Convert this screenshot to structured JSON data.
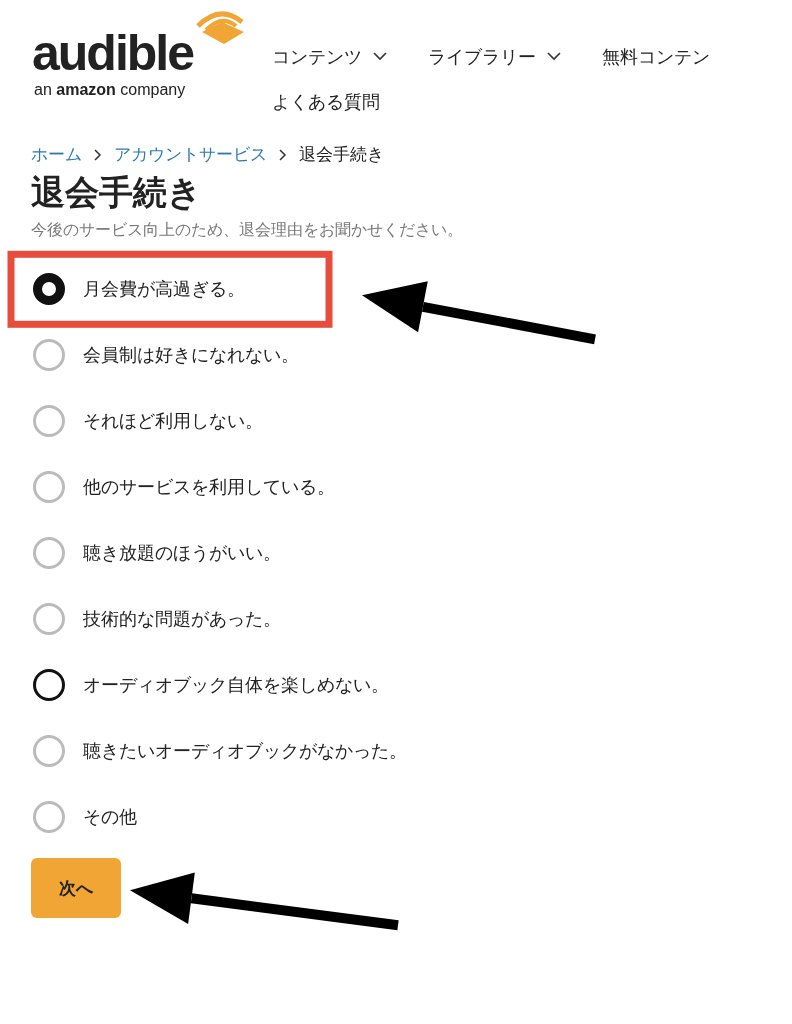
{
  "logo": {
    "name": "audible",
    "tagline": "an **amazon** company"
  },
  "nav": [
    {
      "label": "コンテンツ",
      "dropdown": true
    },
    {
      "label": "ライブラリー",
      "dropdown": true
    },
    {
      "label": "無料コンテン",
      "dropdown": false
    },
    {
      "label": "よくある質問",
      "dropdown": false
    }
  ],
  "breadcrumb": [
    {
      "label": "ホーム",
      "link": true
    },
    {
      "label": "アカウントサービス",
      "link": true
    },
    {
      "label": "退会手続き",
      "link": false
    }
  ],
  "title": "退会手続き",
  "subtitle": "今後のサービス向上のため、退会理由をお聞かせください。",
  "options": [
    {
      "label": "月会費が高過ぎる。",
      "selected": true,
      "focused": false,
      "highlighted": true,
      "arrow": true
    },
    {
      "label": "会員制は好きになれない。",
      "selected": false,
      "focused": false,
      "highlighted": false,
      "arrow": false
    },
    {
      "label": "それほど利用しない。",
      "selected": false,
      "focused": false,
      "highlighted": false,
      "arrow": false
    },
    {
      "label": "他のサービスを利用している。",
      "selected": false,
      "focused": false,
      "highlighted": false,
      "arrow": false
    },
    {
      "label": "聴き放題のほうがいい。",
      "selected": false,
      "focused": false,
      "highlighted": false,
      "arrow": false
    },
    {
      "label": "技術的な問題があった。",
      "selected": false,
      "focused": false,
      "highlighted": false,
      "arrow": false
    },
    {
      "label": "オーディオブック自体を楽しめない。",
      "selected": false,
      "focused": true,
      "highlighted": false,
      "arrow": false
    },
    {
      "label": "聴きたいオーディオブックがなかった。",
      "selected": false,
      "focused": false,
      "highlighted": false,
      "arrow": false
    },
    {
      "label": "その他",
      "selected": false,
      "focused": false,
      "highlighted": false,
      "arrow": false
    }
  ],
  "next_button": {
    "label": "次へ",
    "arrow": true
  }
}
